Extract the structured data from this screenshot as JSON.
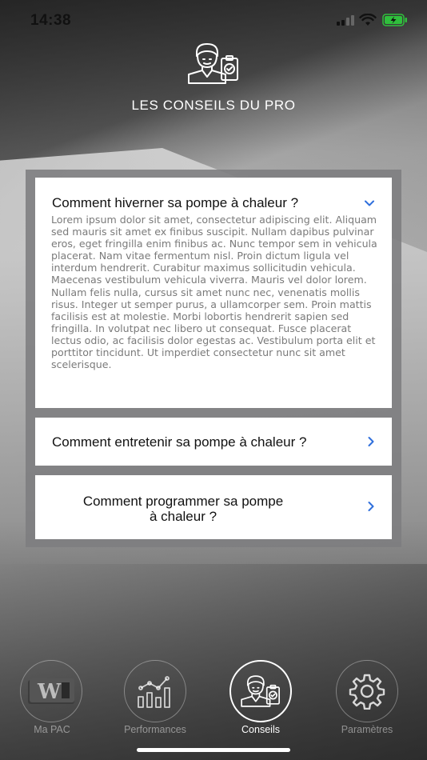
{
  "status": {
    "time": "14:38"
  },
  "header": {
    "title": "LES CONSEILS DU PRO",
    "icon": "advisor-icon"
  },
  "faq": [
    {
      "question": "Comment hiverner sa pompe à chaleur ?",
      "expanded": true,
      "answer": "Lorem ipsum dolor sit amet, consectetur adipiscing elit. Aliquam sed mauris sit amet ex finibus suscipit. Nullam dapibus pulvinar eros, eget fringilla enim finibus ac. Nunc tempor sem in vehicula placerat. Nam vitae fermentum nisl. Proin dictum ligula vel interdum hendrerit. Curabitur maximus sollicitudin vehicula. Maecenas vestibulum vehicula viverra. Mauris vel dolor lorem. Nullam felis nulla, cursus sit amet nunc nec, venenatis mollis risus. Integer ut semper purus, a ullamcorper sem. Proin mattis facilisis est at molestie. Morbi lobortis hendrerit sapien sed fringilla. In volutpat nec libero ut consequat. Fusce placerat lectus odio, ac facilisis dolor egestas ac. Vestibulum porta elit et porttitor tincidunt. Ut imperdiet consectetur nunc sit amet scelerisque."
    },
    {
      "question": "Comment entretenir sa pompe à chaleur ?",
      "expanded": false
    },
    {
      "question_line1": "Comment programmer sa pompe",
      "question_line2": "à chaleur ?",
      "expanded": false
    }
  ],
  "nav": {
    "items": [
      {
        "label": "Ma PAC",
        "icon": "heat-pump-logo-icon",
        "active": false
      },
      {
        "label": "Performances",
        "icon": "chart-icon",
        "active": false
      },
      {
        "label": "Conseils",
        "icon": "advisor-icon",
        "active": true
      },
      {
        "label": "Paramètres",
        "icon": "gear-icon",
        "active": false
      }
    ]
  },
  "colors": {
    "accent": "#2f6fdc",
    "panel": "#7d7d80",
    "card": "#ffffff",
    "answer_text": "#7a7a7a"
  }
}
